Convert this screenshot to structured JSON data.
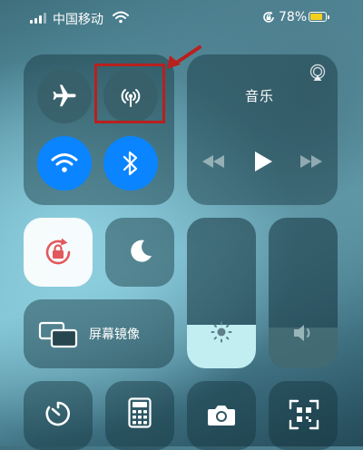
{
  "status_bar": {
    "carrier": "中国移动",
    "battery_percent": "78%",
    "battery_level": 0.78
  },
  "connectivity": {
    "airplane_icon": "airplane-icon",
    "cellular_icon": "cellular-antenna-icon",
    "wifi_icon": "wifi-icon",
    "bluetooth_icon": "bluetooth-icon"
  },
  "music": {
    "title": "音乐",
    "airplay_icon": "airplay-icon",
    "controls": [
      "previous-icon",
      "play-icon",
      "next-icon"
    ]
  },
  "screen_mirroring": {
    "label": "屏幕镜像"
  },
  "sliders": {
    "brightness_level": 0.29,
    "volume_level": 0.27
  },
  "colors": {
    "accent_blue": "#0a84ff",
    "rotation_lock_red": "#e2585c",
    "battery_yellow": "#f5d020",
    "annotation_red": "#b8201e"
  },
  "bottom_row": [
    "timer-icon",
    "calculator-icon",
    "camera-icon",
    "qr-scanner-icon"
  ]
}
